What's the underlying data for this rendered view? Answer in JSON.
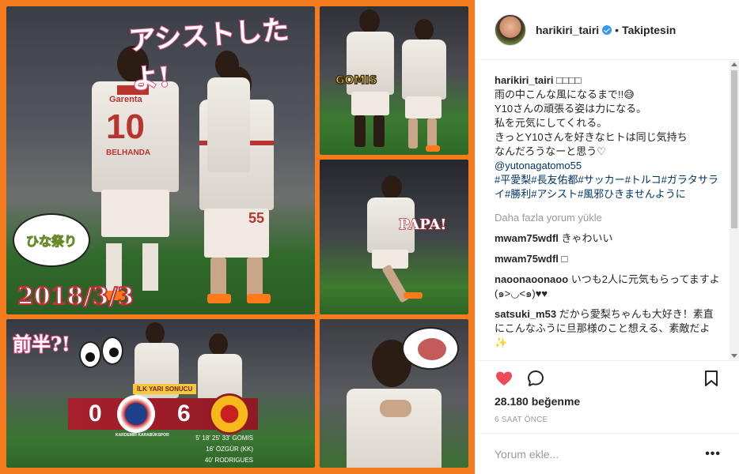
{
  "collage": {
    "main_title": "アシストしたよ!",
    "date_text": "2018/3/3",
    "speech_text": "ひな祭り",
    "jersey_sponsor": "Garenta",
    "jersey_number_10": "10",
    "jersey_name": "BELHANDA",
    "jersey_number_55": "55",
    "tr_label": "GOMIS",
    "mr_label": "PAPA!",
    "bl_title": "前半?!",
    "score_label": "İLK YARI SONUCU",
    "home_score": "0",
    "away_score": "6",
    "home_team": "KARDEMIR KARABÜKSPOR",
    "scorers": [
      "5' 18' 25' 33' GOMIS",
      "16' ÖZGÜR (KK)",
      "40' RODRIGUES"
    ]
  },
  "header": {
    "username": "harikiri_tairi",
    "follow_status": "Takiptesin"
  },
  "caption": {
    "username": "harikiri_tairi",
    "lines": [
      "□□□□",
      "雨の中こんな風になるまで!!😅",
      "Y10さんの頑張る姿は力になる。",
      "私を元気にしてくれる。",
      "きっとY10さんを好きなヒトは同じ気持ち",
      "なんだろうなーと思う♡"
    ],
    "mention": "@yutonagatomo55",
    "hashtags": "#平愛梨#長友佑都#サッカー#トルコ#ガラタサライ#勝利#アシスト#風邪ひきませんように"
  },
  "load_more": "Daha fazla yorum yükle",
  "comments": [
    {
      "user": "mwam75wdfl",
      "text": "きゃわいい"
    },
    {
      "user": "mwam75wdfl",
      "text": "□"
    },
    {
      "user": "naoonaoonaoo",
      "text": "いつも2人に元気もらってますよ(๑>◡<๑)♥♥"
    },
    {
      "user": "satsuki_m53",
      "text": "だから愛梨ちゃんも大好き！素直にこんなふうに旦那様のこと想える、素敵だよ✨"
    }
  ],
  "likes": {
    "count": "28.180",
    "label": "beğenme"
  },
  "time_ago": "6 SAAT ÖNCE",
  "comment_box": {
    "placeholder": "Yorum ekle...",
    "more_label": "•••"
  },
  "colors": {
    "frame": "#f57b1f",
    "club_red": "#a71f2c",
    "link": "#003569",
    "heart": "#ed4956"
  }
}
